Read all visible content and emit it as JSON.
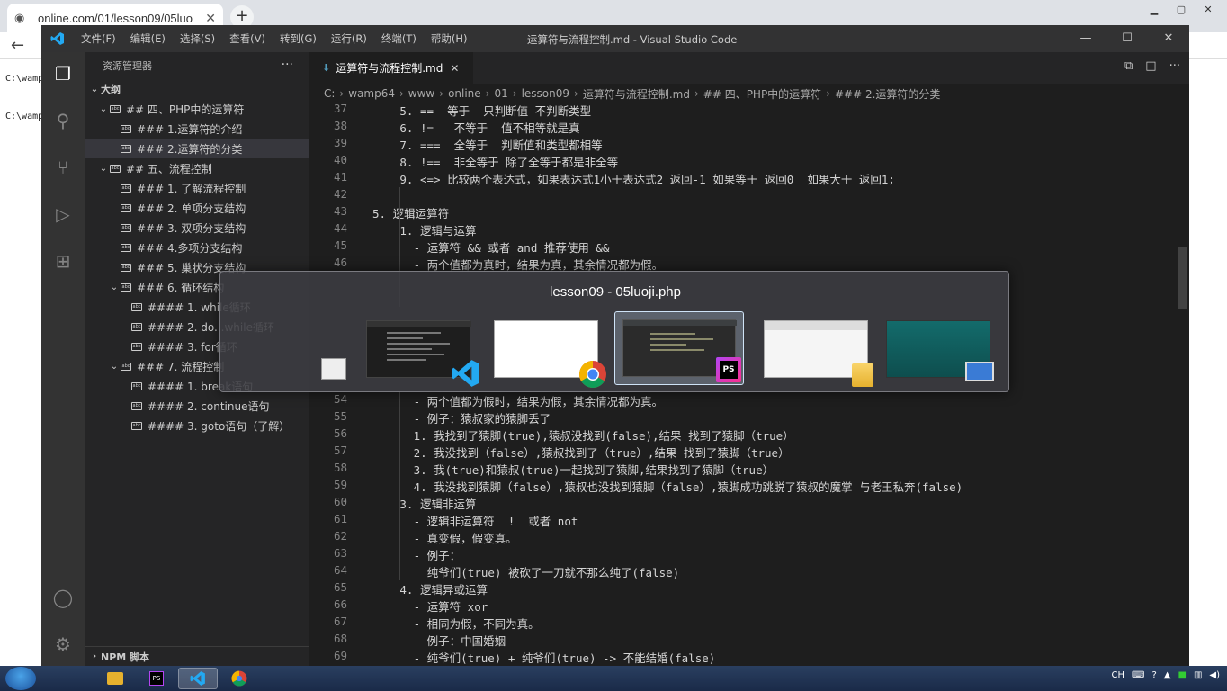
{
  "browser": {
    "tab_title": "online.com/01/lesson09/05luo",
    "close": "✕",
    "new_tab": "+",
    "terminal_lines": [
      "C:\\wamp",
      "C:\\wamp"
    ]
  },
  "vscode": {
    "menu": [
      "文件(F)",
      "编辑(E)",
      "选择(S)",
      "查看(V)",
      "转到(G)",
      "运行(R)",
      "终端(T)",
      "帮助(H)"
    ],
    "window_title": "运算符与流程控制.md - Visual Studio Code",
    "sidebar_title": "资源管理器",
    "outline_title": "大纲",
    "outline": [
      {
        "level": 0,
        "label": "## 四、PHP中的运算符",
        "chev": "⌄"
      },
      {
        "level": 1,
        "label": "### 1.运算符的介绍",
        "chev": ""
      },
      {
        "level": 1,
        "label": "### 2.运算符的分类",
        "chev": "",
        "selected": true
      },
      {
        "level": 0,
        "label": "## 五、流程控制",
        "chev": "⌄"
      },
      {
        "level": 1,
        "label": "### 1. 了解流程控制",
        "chev": ""
      },
      {
        "level": 1,
        "label": "### 2. 单项分支结构",
        "chev": ""
      },
      {
        "level": 1,
        "label": "### 3. 双项分支结构",
        "chev": ""
      },
      {
        "level": 1,
        "label": "### 4.多项分支结构",
        "chev": ""
      },
      {
        "level": 1,
        "label": "### 5. 巢状分支结构",
        "chev": ""
      },
      {
        "level": 1,
        "label": "### 6. 循环结构",
        "chev": "⌄"
      },
      {
        "level": 2,
        "label": "#### 1. while循环",
        "chev": ""
      },
      {
        "level": 2,
        "label": "#### 2. do...while循环",
        "chev": ""
      },
      {
        "level": 2,
        "label": "#### 3. for循环",
        "chev": ""
      },
      {
        "level": 1,
        "label": "### 7. 流程控制",
        "chev": "⌄"
      },
      {
        "level": 2,
        "label": "#### 1. break语句",
        "chev": ""
      },
      {
        "level": 2,
        "label": "#### 2. continue语句",
        "chev": ""
      },
      {
        "level": 2,
        "label": "#### 3. goto语句（了解）",
        "chev": ""
      }
    ],
    "npm_section": "NPM 脚本",
    "tab_label": "运算符与流程控制.md",
    "breadcrumb": [
      "C:",
      "wamp64",
      "www",
      "online",
      "01",
      "lesson09",
      "运算符与流程控制.md",
      "## 四、PHP中的运算符",
      "### 2.运算符的分类"
    ],
    "lines": [
      {
        "n": "37",
        "indent": 4,
        "t": "5. ==  等于  只判断值 不判断类型"
      },
      {
        "n": "38",
        "indent": 4,
        "t": "6. !=   不等于  值不相等就是真"
      },
      {
        "n": "39",
        "indent": 4,
        "t": "7. ===  全等于  判断值和类型都相等"
      },
      {
        "n": "40",
        "indent": 4,
        "t": "8. !==  非全等于 除了全等于都是非全等"
      },
      {
        "n": "41",
        "indent": 4,
        "t": "9. <=> 比较两个表达式，如果表达式1小于表达式2 返回-1 如果等于 返回0  如果大于 返回1;"
      },
      {
        "n": "42",
        "indent": 0,
        "t": ""
      },
      {
        "n": "43",
        "indent": 0,
        "t": "5. 逻辑运算符"
      },
      {
        "n": "44",
        "indent": 4,
        "t": "1. 逻辑与运算"
      },
      {
        "n": "45",
        "indent": 6,
        "t": "- 运算符 && 或者 and 推荐使用 &&"
      },
      {
        "n": "46",
        "indent": 6,
        "t": "- 两个值都为真时，结果为真，其余情况都为假。"
      },
      {
        "n": "54",
        "indent": 6,
        "t": "- 两个值都为假时，结果为假，其余情况都为真。"
      },
      {
        "n": "55",
        "indent": 6,
        "t": "- 例子：猿叔家的猿脚丢了"
      },
      {
        "n": "56",
        "indent": 6,
        "t": "1. 我找到了猿脚(true),猿叔没找到(false),结果 找到了猿脚（true）"
      },
      {
        "n": "57",
        "indent": 6,
        "t": "2. 我没找到（false）,猿叔找到了（true）,结果 找到了猿脚（true）"
      },
      {
        "n": "58",
        "indent": 6,
        "t": "3. 我(true)和猿叔(true)一起找到了猿脚,结果找到了猿脚（true）"
      },
      {
        "n": "59",
        "indent": 6,
        "t": "4. 我没找到猿脚（false）,猿叔也没找到猿脚（false）,猿脚成功跳脱了猿叔的魔掌 与老王私奔(false)"
      },
      {
        "n": "60",
        "indent": 4,
        "t": "3. 逻辑非运算"
      },
      {
        "n": "61",
        "indent": 6,
        "t": "- 逻辑非运算符  !  或者 not"
      },
      {
        "n": "62",
        "indent": 6,
        "t": "- 真变假，假变真。"
      },
      {
        "n": "63",
        "indent": 6,
        "t": "- 例子："
      },
      {
        "n": "64",
        "indent": 8,
        "t": "纯爷们(true) 被砍了一刀就不那么纯了(false)"
      },
      {
        "n": "65",
        "indent": 4,
        "t": "4. 逻辑异或运算"
      },
      {
        "n": "66",
        "indent": 6,
        "t": "- 运算符 xor"
      },
      {
        "n": "67",
        "indent": 6,
        "t": "- 相同为假，不同为真。"
      },
      {
        "n": "68",
        "indent": 6,
        "t": "- 例子：中国婚姻"
      },
      {
        "n": "69",
        "indent": 6,
        "t": "- 纯爷们(true) + 纯爷们(true) -> 不能结婚(false)"
      }
    ]
  },
  "alttab": {
    "title": "lesson09 - 05luoji.php",
    "thumbs": [
      "vscode",
      "chrome",
      "phpstorm",
      "explorer",
      "desktop"
    ]
  },
  "taskbar": {
    "lang": "CH"
  }
}
